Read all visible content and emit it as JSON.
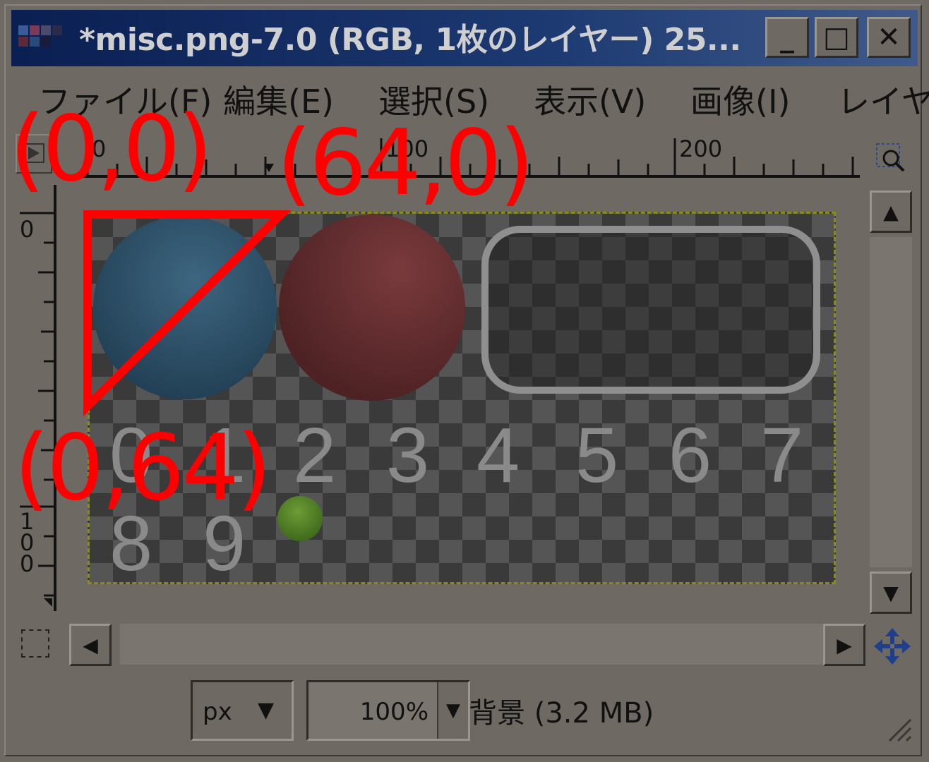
{
  "window": {
    "title": "*misc.png-7.0 (RGB, 1枚のレイヤー) 25...",
    "minimize_glyph": "_",
    "maximize_glyph": "□",
    "close_glyph": "✕"
  },
  "menu": {
    "items": [
      "ファイル(F)",
      "編集(E)",
      "選択(S)",
      "表示(V)",
      "画像(I)",
      "レイヤ"
    ]
  },
  "ruler": {
    "h_labels": [
      "0",
      "100",
      "200"
    ],
    "v_labels": [
      "0",
      "1\n0\n0"
    ]
  },
  "canvas": {
    "digits": [
      "0",
      "1",
      "2",
      "3",
      "4",
      "5",
      "6",
      "7",
      "8",
      "9"
    ]
  },
  "statusbar": {
    "unit": "px",
    "zoom": "100%",
    "message": "背景 (3.2 MB)"
  },
  "annotations": {
    "label_origin": "(0,0)",
    "label_x64": "(64,0)",
    "label_y64": "(0,64)"
  },
  "colors": {
    "annotation": "#ff0000",
    "titlebar_start": "#0a1f52",
    "titlebar_end": "#3f5a8a",
    "blue_sphere": "#2f556d",
    "red_sphere": "#6b3030",
    "green_sphere": "#5a8a2a"
  }
}
